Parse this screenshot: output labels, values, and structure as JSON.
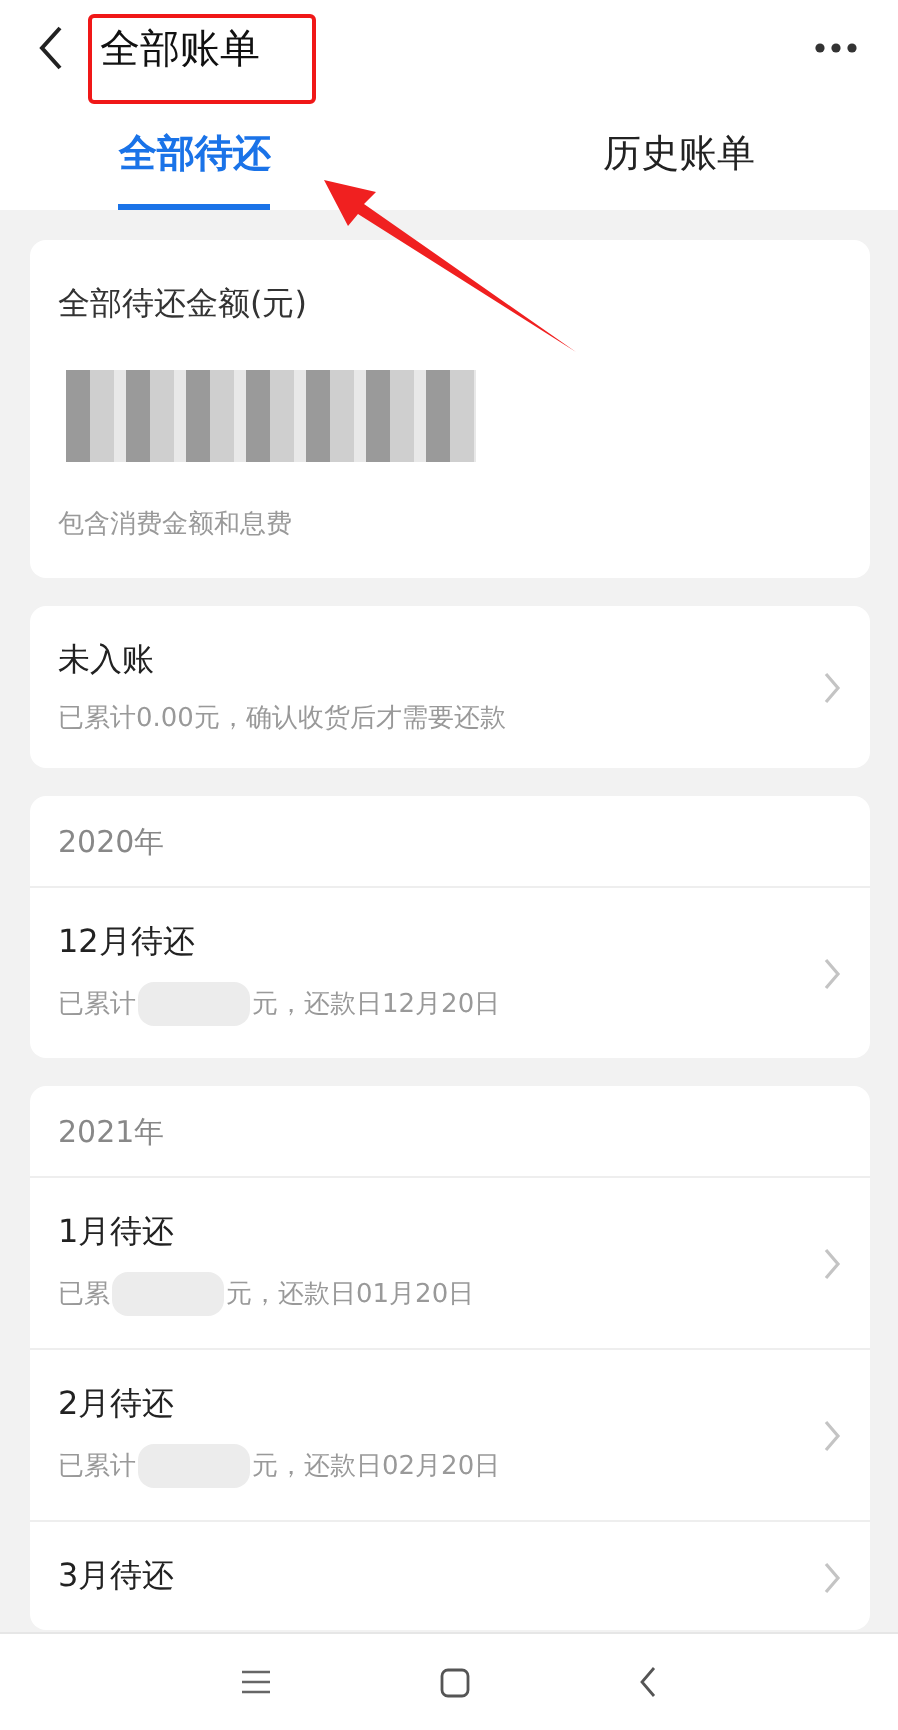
{
  "header": {
    "title": "全部账单",
    "highlighted": true
  },
  "tabs": [
    {
      "label": "全部待还",
      "selected": true,
      "pointed_at": true
    },
    {
      "label": "历史账单",
      "selected": false,
      "pointed_at": false
    }
  ],
  "summary": {
    "label": "全部待还金额(元)",
    "amount_hidden": true,
    "note": "包含消费金额和息费"
  },
  "unposted": {
    "title": "未入账",
    "detail": "已累计0.00元，确认收货后才需要还款"
  },
  "years": [
    {
      "year": "2020年",
      "bills": [
        {
          "title": "12月待还",
          "prefix": "已累计",
          "suffix": "元，还款日12月20日"
        }
      ]
    },
    {
      "year": "2021年",
      "bills": [
        {
          "title": "1月待还",
          "prefix": "已累",
          "suffix": "元，还款日01月20日"
        },
        {
          "title": "2月待还",
          "prefix": "已累计",
          "suffix": "元，还款日02月20日"
        },
        {
          "title": "3月待还"
        }
      ]
    }
  ]
}
